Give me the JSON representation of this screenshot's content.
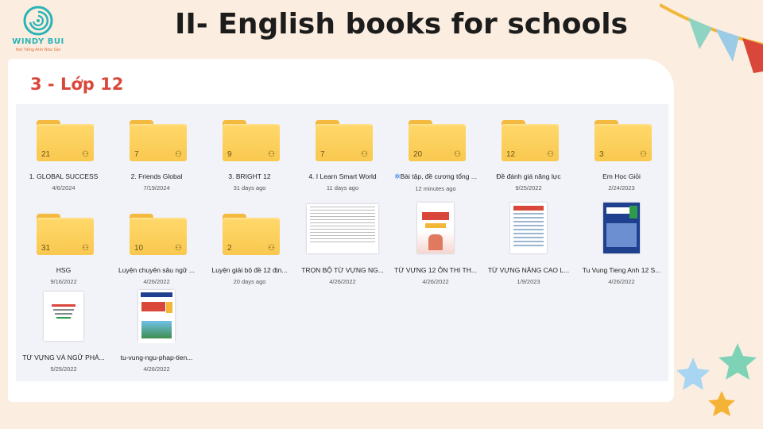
{
  "logo": {
    "name": "WINDY BUI",
    "tagline": "Nói Tiếng Anh Như Gió"
  },
  "slide": {
    "title": "II- English books for schools",
    "subtitle": "3 - Lớp 12"
  },
  "colors": {
    "folder": "#f9c84f",
    "accent_red": "#d9473a",
    "brand_teal": "#2bb3b6",
    "background": "#fbeee0",
    "explorer": "#f2f3f8"
  },
  "explorer": {
    "items": [
      {
        "type": "folder",
        "count": "21",
        "label": "1. GLOBAL SUCCESS",
        "date": "4/6/2024",
        "icon": "shared-people-icon"
      },
      {
        "type": "folder",
        "count": "7",
        "label": "2. Friends Global",
        "date": "7/19/2024",
        "icon": "shared-people-icon"
      },
      {
        "type": "folder",
        "count": "9",
        "label": "3. BRIGHT 12",
        "date": "31 days ago",
        "icon": "shared-people-icon"
      },
      {
        "type": "folder",
        "count": "7",
        "label": "4. I Learn Smart World",
        "date": "11 days ago",
        "icon": "shared-people-icon"
      },
      {
        "type": "folder",
        "count": "20",
        "label": "Bài tập, đề cương tổng ...",
        "date": "12 minutes ago",
        "icon": "shared-people-icon",
        "syncing": true
      },
      {
        "type": "folder",
        "count": "12",
        "label": "Đề đánh giá năng lực",
        "date": "9/25/2022",
        "icon": "shared-people-icon"
      },
      {
        "type": "folder",
        "count": "3",
        "label": "Em Học Giỏi",
        "date": "2/24/2023",
        "icon": "shared-people-icon"
      },
      {
        "type": "folder",
        "count": "31",
        "label": "HSG",
        "date": "9/16/2022",
        "icon": "shared-people-icon"
      },
      {
        "type": "folder",
        "count": "10",
        "label": "Luyện chuyên sâu ngữ ...",
        "date": "4/26/2022",
        "icon": "shared-people-icon"
      },
      {
        "type": "folder",
        "count": "2",
        "label": "Luyện giải bộ đề 12 địn...",
        "date": "20 days ago",
        "icon": "shared-people-icon"
      },
      {
        "type": "file",
        "thumb": "document-table",
        "label": "TRỌN BỘ TỪ VỰNG NG...",
        "date": "4/26/2022"
      },
      {
        "type": "file",
        "thumb": "book-cover-red",
        "label": "TỪ VỰNG 12 ÔN THI TH...",
        "date": "4/26/2022"
      },
      {
        "type": "file",
        "thumb": "document-table-red",
        "label": "TỪ VỰNG NÂNG CAO L...",
        "date": "1/9/2023"
      },
      {
        "type": "file",
        "thumb": "book-cover-blue",
        "label": "Tu Vung Tieng Anh 12 S...",
        "date": "4/26/2022"
      },
      {
        "type": "file",
        "thumb": "document-plain",
        "label": "TỪ VỰNG VÀ NGỮ PHÁ...",
        "date": "5/25/2022"
      },
      {
        "type": "file",
        "thumb": "book-cover-colorful",
        "label": "tu-vung-ngu-phap-tien...",
        "date": "4/26/2022"
      }
    ]
  }
}
